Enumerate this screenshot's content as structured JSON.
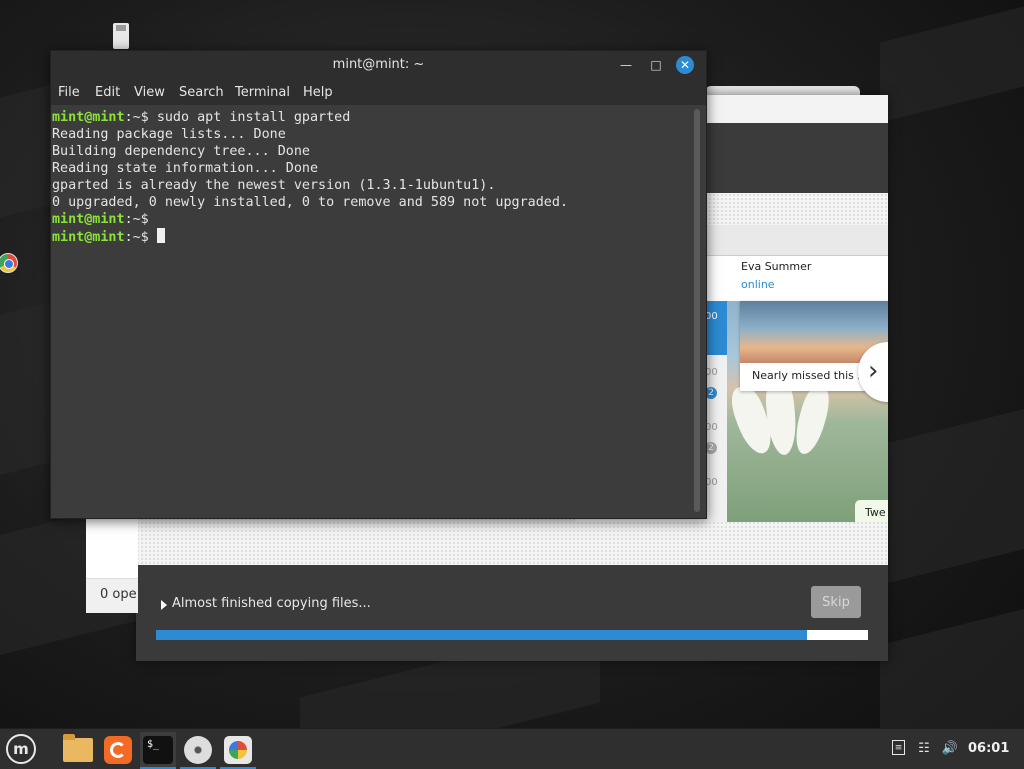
{
  "terminal": {
    "title": "mint@mint: ~",
    "menu": [
      "File",
      "Edit",
      "View",
      "Search",
      "Terminal",
      "Help"
    ],
    "lines": [
      {
        "prompt": "mint@mint",
        "path": ":~$ ",
        "text": "sudo apt install gparted"
      },
      {
        "text": "Reading package lists... Done"
      },
      {
        "text": "Building dependency tree... Done"
      },
      {
        "text": "Reading state information... Done"
      },
      {
        "text": "gparted is already the newest version (1.3.1-1ubuntu1)."
      },
      {
        "text": "0 upgraded, 0 newly installed, 0 to remove and 589 not upgraded."
      },
      {
        "prompt": "mint@mint",
        "path": ":~$ ",
        "text": ""
      },
      {
        "prompt": "mint@mint",
        "path": ":~$ ",
        "text": ""
      }
    ]
  },
  "installer": {
    "status": "Almost finished copying files...",
    "skip_label": "Skip",
    "progress": 0.915,
    "slide": {
      "contact_name": "Eva Summer",
      "contact_status": "online",
      "caption": "Nearly missed this s",
      "tweet": "Twe",
      "counts": [
        "00",
        "00",
        "00",
        "00"
      ],
      "badges": [
        "2",
        "2"
      ]
    }
  },
  "file_manager": {
    "status": "0 ope"
  },
  "taskbar": {
    "clock": "06:01",
    "apps": [
      "menu-icon",
      "files-icon",
      "firefox-icon",
      "terminal-icon",
      "disc-icon",
      "paint-icon"
    ],
    "tray": [
      "notes-icon",
      "network-icon",
      "volume-icon"
    ],
    "accent": "#2c8bd3"
  }
}
